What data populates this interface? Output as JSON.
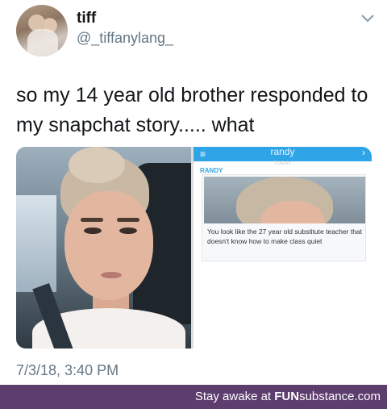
{
  "tweet": {
    "author_name": "tiff",
    "author_handle": "@_tiffanylang_",
    "text": "so my 14 year old brother responded to my snapchat story..... what",
    "timestamp": "7/3/18, 3:40 PM"
  },
  "snapchat": {
    "chat_title": "randy",
    "day_label": "TODAY",
    "sender_label": "RANDY",
    "reply_text": "You look like the 27 year old substitute teacher that doesn't know how to make class quiet"
  },
  "icons": {
    "menu": "menu-icon",
    "forward": "chevron-right-icon",
    "more": "chevron-down-icon"
  },
  "footer": {
    "tagline": "Stay awake at ",
    "brand_bold": "FUN",
    "brand_rest": "substance",
    "brand_suffix": ".com"
  },
  "colors": {
    "snap_blue": "#2fa4e7",
    "footer_purple": "#5d3c6e",
    "handle_gray": "#657786"
  }
}
